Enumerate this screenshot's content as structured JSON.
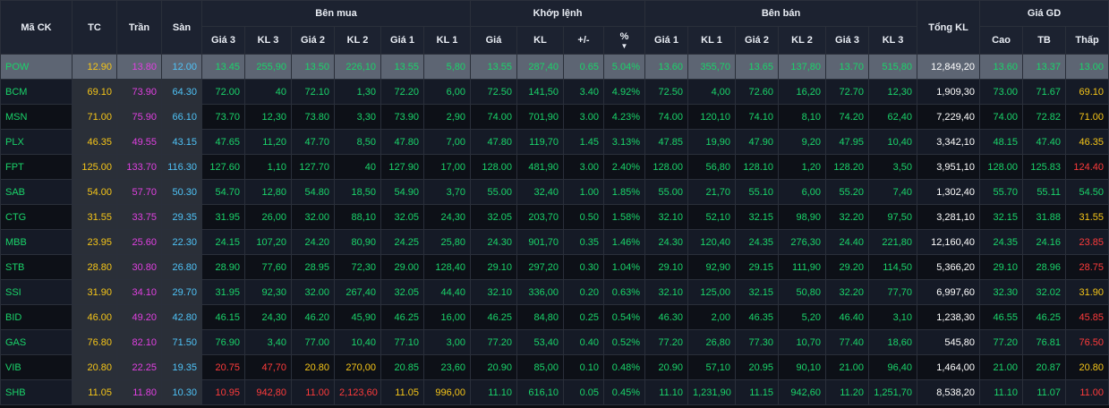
{
  "colors": {
    "up": "#1ad46a",
    "ref": "#f5c518",
    "down": "#ff3b3b",
    "ceil": "#e040e0",
    "floor": "#4fc3f7"
  },
  "sort_icon": "caret-down-icon",
  "headers": {
    "ma_ck": "Mã CK",
    "tc": "TC",
    "tran": "Trần",
    "san": "Sàn",
    "ben_mua": "Bên mua",
    "khop_lenh": "Khớp lệnh",
    "ben_ban": "Bên bán",
    "tong_kl": "Tổng KL",
    "gia_gd": "Giá GD",
    "gia3": "Giá 3",
    "kl3": "KL 3",
    "gia2": "Giá 2",
    "kl2": "KL 2",
    "gia1": "Giá 1",
    "kl1": "KL 1",
    "gia": "Giá",
    "kl": "KL",
    "change": "+/-",
    "pct": "%",
    "cao": "Cao",
    "tb": "TB",
    "thap": "Thấp"
  },
  "rows": [
    {
      "sym": "POW",
      "tc": "12.90",
      "tran": "13.80",
      "san": "12.00",
      "b3p": "13.45",
      "b3v": "255,90",
      "b2p": "13.50",
      "b2v": "226,10",
      "b1p": "13.55",
      "b1v": "5,80",
      "mp": "13.55",
      "mv": "287,40",
      "ch": "0.65",
      "pct": "5.04%",
      "s1p": "13.60",
      "s1v": "355,70",
      "s2p": "13.65",
      "s2v": "137,80",
      "s3p": "13.70",
      "s3v": "515,80",
      "tkl": "12,849,20",
      "hi": "13.60",
      "avg": "13.37",
      "lo": "13.00",
      "c": {
        "sym": "up",
        "b3": "up",
        "b2": "up",
        "b1": "up",
        "m": "up",
        "s1": "up",
        "s2": "up",
        "s3": "up",
        "hi": "up",
        "avg": "up",
        "lo": "up"
      }
    },
    {
      "sym": "BCM",
      "tc": "69.10",
      "tran": "73.90",
      "san": "64.30",
      "b3p": "72.00",
      "b3v": "40",
      "b2p": "72.10",
      "b2v": "1,30",
      "b1p": "72.20",
      "b1v": "6,00",
      "mp": "72.50",
      "mv": "141,50",
      "ch": "3.40",
      "pct": "4.92%",
      "s1p": "72.50",
      "s1v": "4,00",
      "s2p": "72.60",
      "s2v": "16,20",
      "s3p": "72.70",
      "s3v": "12,30",
      "tkl": "1,909,30",
      "hi": "73.00",
      "avg": "71.67",
      "lo": "69.10",
      "c": {
        "sym": "up",
        "b3": "up",
        "b2": "up",
        "b1": "up",
        "m": "up",
        "s1": "up",
        "s2": "up",
        "s3": "up",
        "hi": "up",
        "avg": "up",
        "lo": "ref"
      }
    },
    {
      "sym": "MSN",
      "tc": "71.00",
      "tran": "75.90",
      "san": "66.10",
      "b3p": "73.70",
      "b3v": "12,30",
      "b2p": "73.80",
      "b2v": "3,30",
      "b1p": "73.90",
      "b1v": "2,90",
      "mp": "74.00",
      "mv": "701,90",
      "ch": "3.00",
      "pct": "4.23%",
      "s1p": "74.00",
      "s1v": "120,10",
      "s2p": "74.10",
      "s2v": "8,10",
      "s3p": "74.20",
      "s3v": "62,40",
      "tkl": "7,229,40",
      "hi": "74.00",
      "avg": "72.82",
      "lo": "71.00",
      "c": {
        "sym": "up",
        "b3": "up",
        "b2": "up",
        "b1": "up",
        "m": "up",
        "s1": "up",
        "s2": "up",
        "s3": "up",
        "hi": "up",
        "avg": "up",
        "lo": "ref"
      }
    },
    {
      "sym": "PLX",
      "tc": "46.35",
      "tran": "49.55",
      "san": "43.15",
      "b3p": "47.65",
      "b3v": "11,20",
      "b2p": "47.70",
      "b2v": "8,50",
      "b1p": "47.80",
      "b1v": "7,00",
      "mp": "47.80",
      "mv": "119,70",
      "ch": "1.45",
      "pct": "3.13%",
      "s1p": "47.85",
      "s1v": "19,90",
      "s2p": "47.90",
      "s2v": "9,20",
      "s3p": "47.95",
      "s3v": "10,40",
      "tkl": "3,342,10",
      "hi": "48.15",
      "avg": "47.40",
      "lo": "46.35",
      "c": {
        "sym": "up",
        "b3": "up",
        "b2": "up",
        "b1": "up",
        "m": "up",
        "s1": "up",
        "s2": "up",
        "s3": "up",
        "hi": "up",
        "avg": "up",
        "lo": "ref"
      }
    },
    {
      "sym": "FPT",
      "tc": "125.00",
      "tran": "133.70",
      "san": "116.30",
      "b3p": "127.60",
      "b3v": "1,10",
      "b2p": "127.70",
      "b2v": "40",
      "b1p": "127.90",
      "b1v": "17,00",
      "mp": "128.00",
      "mv": "481,90",
      "ch": "3.00",
      "pct": "2.40%",
      "s1p": "128.00",
      "s1v": "56,80",
      "s2p": "128.10",
      "s2v": "1,20",
      "s3p": "128.20",
      "s3v": "3,50",
      "tkl": "3,951,10",
      "hi": "128.00",
      "avg": "125.83",
      "lo": "124.40",
      "c": {
        "sym": "up",
        "b3": "up",
        "b2": "up",
        "b1": "up",
        "m": "up",
        "s1": "up",
        "s2": "up",
        "s3": "up",
        "hi": "up",
        "avg": "up",
        "lo": "down"
      }
    },
    {
      "sym": "SAB",
      "tc": "54.00",
      "tran": "57.70",
      "san": "50.30",
      "b3p": "54.70",
      "b3v": "12,80",
      "b2p": "54.80",
      "b2v": "18,50",
      "b1p": "54.90",
      "b1v": "3,70",
      "mp": "55.00",
      "mv": "32,40",
      "ch": "1.00",
      "pct": "1.85%",
      "s1p": "55.00",
      "s1v": "21,70",
      "s2p": "55.10",
      "s2v": "6,00",
      "s3p": "55.20",
      "s3v": "7,40",
      "tkl": "1,302,40",
      "hi": "55.70",
      "avg": "55.11",
      "lo": "54.50",
      "c": {
        "sym": "up",
        "b3": "up",
        "b2": "up",
        "b1": "up",
        "m": "up",
        "s1": "up",
        "s2": "up",
        "s3": "up",
        "hi": "up",
        "avg": "up",
        "lo": "up"
      }
    },
    {
      "sym": "CTG",
      "tc": "31.55",
      "tran": "33.75",
      "san": "29.35",
      "b3p": "31.95",
      "b3v": "26,00",
      "b2p": "32.00",
      "b2v": "88,10",
      "b1p": "32.05",
      "b1v": "24,30",
      "mp": "32.05",
      "mv": "203,70",
      "ch": "0.50",
      "pct": "1.58%",
      "s1p": "32.10",
      "s1v": "52,10",
      "s2p": "32.15",
      "s2v": "98,90",
      "s3p": "32.20",
      "s3v": "97,50",
      "tkl": "3,281,10",
      "hi": "32.15",
      "avg": "31.88",
      "lo": "31.55",
      "c": {
        "sym": "up",
        "b3": "up",
        "b2": "up",
        "b1": "up",
        "m": "up",
        "s1": "up",
        "s2": "up",
        "s3": "up",
        "hi": "up",
        "avg": "up",
        "lo": "ref"
      }
    },
    {
      "sym": "MBB",
      "tc": "23.95",
      "tran": "25.60",
      "san": "22.30",
      "b3p": "24.15",
      "b3v": "107,20",
      "b2p": "24.20",
      "b2v": "80,90",
      "b1p": "24.25",
      "b1v": "25,80",
      "mp": "24.30",
      "mv": "901,70",
      "ch": "0.35",
      "pct": "1.46%",
      "s1p": "24.30",
      "s1v": "120,40",
      "s2p": "24.35",
      "s2v": "276,30",
      "s3p": "24.40",
      "s3v": "221,80",
      "tkl": "12,160,40",
      "hi": "24.35",
      "avg": "24.16",
      "lo": "23.85",
      "c": {
        "sym": "up",
        "b3": "up",
        "b2": "up",
        "b1": "up",
        "m": "up",
        "s1": "up",
        "s2": "up",
        "s3": "up",
        "hi": "up",
        "avg": "up",
        "lo": "down"
      }
    },
    {
      "sym": "STB",
      "tc": "28.80",
      "tran": "30.80",
      "san": "26.80",
      "b3p": "28.90",
      "b3v": "77,60",
      "b2p": "28.95",
      "b2v": "72,30",
      "b1p": "29.00",
      "b1v": "128,40",
      "mp": "29.10",
      "mv": "297,20",
      "ch": "0.30",
      "pct": "1.04%",
      "s1p": "29.10",
      "s1v": "92,90",
      "s2p": "29.15",
      "s2v": "111,90",
      "s3p": "29.20",
      "s3v": "114,50",
      "tkl": "5,366,20",
      "hi": "29.10",
      "avg": "28.96",
      "lo": "28.75",
      "c": {
        "sym": "up",
        "b3": "up",
        "b2": "up",
        "b1": "up",
        "m": "up",
        "s1": "up",
        "s2": "up",
        "s3": "up",
        "hi": "up",
        "avg": "up",
        "lo": "down"
      }
    },
    {
      "sym": "SSI",
      "tc": "31.90",
      "tran": "34.10",
      "san": "29.70",
      "b3p": "31.95",
      "b3v": "92,30",
      "b2p": "32.00",
      "b2v": "267,40",
      "b1p": "32.05",
      "b1v": "44,40",
      "mp": "32.10",
      "mv": "336,00",
      "ch": "0.20",
      "pct": "0.63%",
      "s1p": "32.10",
      "s1v": "125,00",
      "s2p": "32.15",
      "s2v": "50,80",
      "s3p": "32.20",
      "s3v": "77,70",
      "tkl": "6,997,60",
      "hi": "32.30",
      "avg": "32.02",
      "lo": "31.90",
      "c": {
        "sym": "up",
        "b3": "up",
        "b2": "up",
        "b1": "up",
        "m": "up",
        "s1": "up",
        "s2": "up",
        "s3": "up",
        "hi": "up",
        "avg": "up",
        "lo": "ref"
      }
    },
    {
      "sym": "BID",
      "tc": "46.00",
      "tran": "49.20",
      "san": "42.80",
      "b3p": "46.15",
      "b3v": "24,30",
      "b2p": "46.20",
      "b2v": "45,90",
      "b1p": "46.25",
      "b1v": "16,00",
      "mp": "46.25",
      "mv": "84,80",
      "ch": "0.25",
      "pct": "0.54%",
      "s1p": "46.30",
      "s1v": "2,00",
      "s2p": "46.35",
      "s2v": "5,20",
      "s3p": "46.40",
      "s3v": "3,10",
      "tkl": "1,238,30",
      "hi": "46.55",
      "avg": "46.25",
      "lo": "45.85",
      "c": {
        "sym": "up",
        "b3": "up",
        "b2": "up",
        "b1": "up",
        "m": "up",
        "s1": "up",
        "s2": "up",
        "s3": "up",
        "hi": "up",
        "avg": "up",
        "lo": "down"
      }
    },
    {
      "sym": "GAS",
      "tc": "76.80",
      "tran": "82.10",
      "san": "71.50",
      "b3p": "76.90",
      "b3v": "3,40",
      "b2p": "77.00",
      "b2v": "10,40",
      "b1p": "77.10",
      "b1v": "3,00",
      "mp": "77.20",
      "mv": "53,40",
      "ch": "0.40",
      "pct": "0.52%",
      "s1p": "77.20",
      "s1v": "26,80",
      "s2p": "77.30",
      "s2v": "10,70",
      "s3p": "77.40",
      "s3v": "18,60",
      "tkl": "545,80",
      "hi": "77.20",
      "avg": "76.81",
      "lo": "76.50",
      "c": {
        "sym": "up",
        "b3": "up",
        "b2": "up",
        "b1": "up",
        "m": "up",
        "s1": "up",
        "s2": "up",
        "s3": "up",
        "hi": "up",
        "avg": "up",
        "lo": "down"
      }
    },
    {
      "sym": "VIB",
      "tc": "20.80",
      "tran": "22.25",
      "san": "19.35",
      "b3p": "20.75",
      "b3v": "47,70",
      "b2p": "20.80",
      "b2v": "270,00",
      "b1p": "20.85",
      "b1v": "23,60",
      "mp": "20.90",
      "mv": "85,00",
      "ch": "0.10",
      "pct": "0.48%",
      "s1p": "20.90",
      "s1v": "57,10",
      "s2p": "20.95",
      "s2v": "90,10",
      "s3p": "21.00",
      "s3v": "96,40",
      "tkl": "1,464,00",
      "hi": "21.00",
      "avg": "20.87",
      "lo": "20.80",
      "c": {
        "sym": "up",
        "b3": "down",
        "b2": "ref",
        "b1": "up",
        "m": "up",
        "s1": "up",
        "s2": "up",
        "s3": "up",
        "hi": "up",
        "avg": "up",
        "lo": "ref"
      }
    },
    {
      "sym": "SHB",
      "tc": "11.05",
      "tran": "11.80",
      "san": "10.30",
      "b3p": "10.95",
      "b3v": "942,80",
      "b2p": "11.00",
      "b2v": "2,123,60",
      "b1p": "11.05",
      "b1v": "996,00",
      "mp": "11.10",
      "mv": "616,10",
      "ch": "0.05",
      "pct": "0.45%",
      "s1p": "11.10",
      "s1v": "1,231,90",
      "s2p": "11.15",
      "s2v": "942,60",
      "s3p": "11.20",
      "s3v": "1,251,70",
      "tkl": "8,538,20",
      "hi": "11.10",
      "avg": "11.07",
      "lo": "11.00",
      "c": {
        "sym": "up",
        "b3": "down",
        "b2": "down",
        "b1": "ref",
        "m": "up",
        "s1": "up",
        "s2": "up",
        "s3": "up",
        "hi": "up",
        "avg": "up",
        "lo": "down"
      }
    }
  ]
}
